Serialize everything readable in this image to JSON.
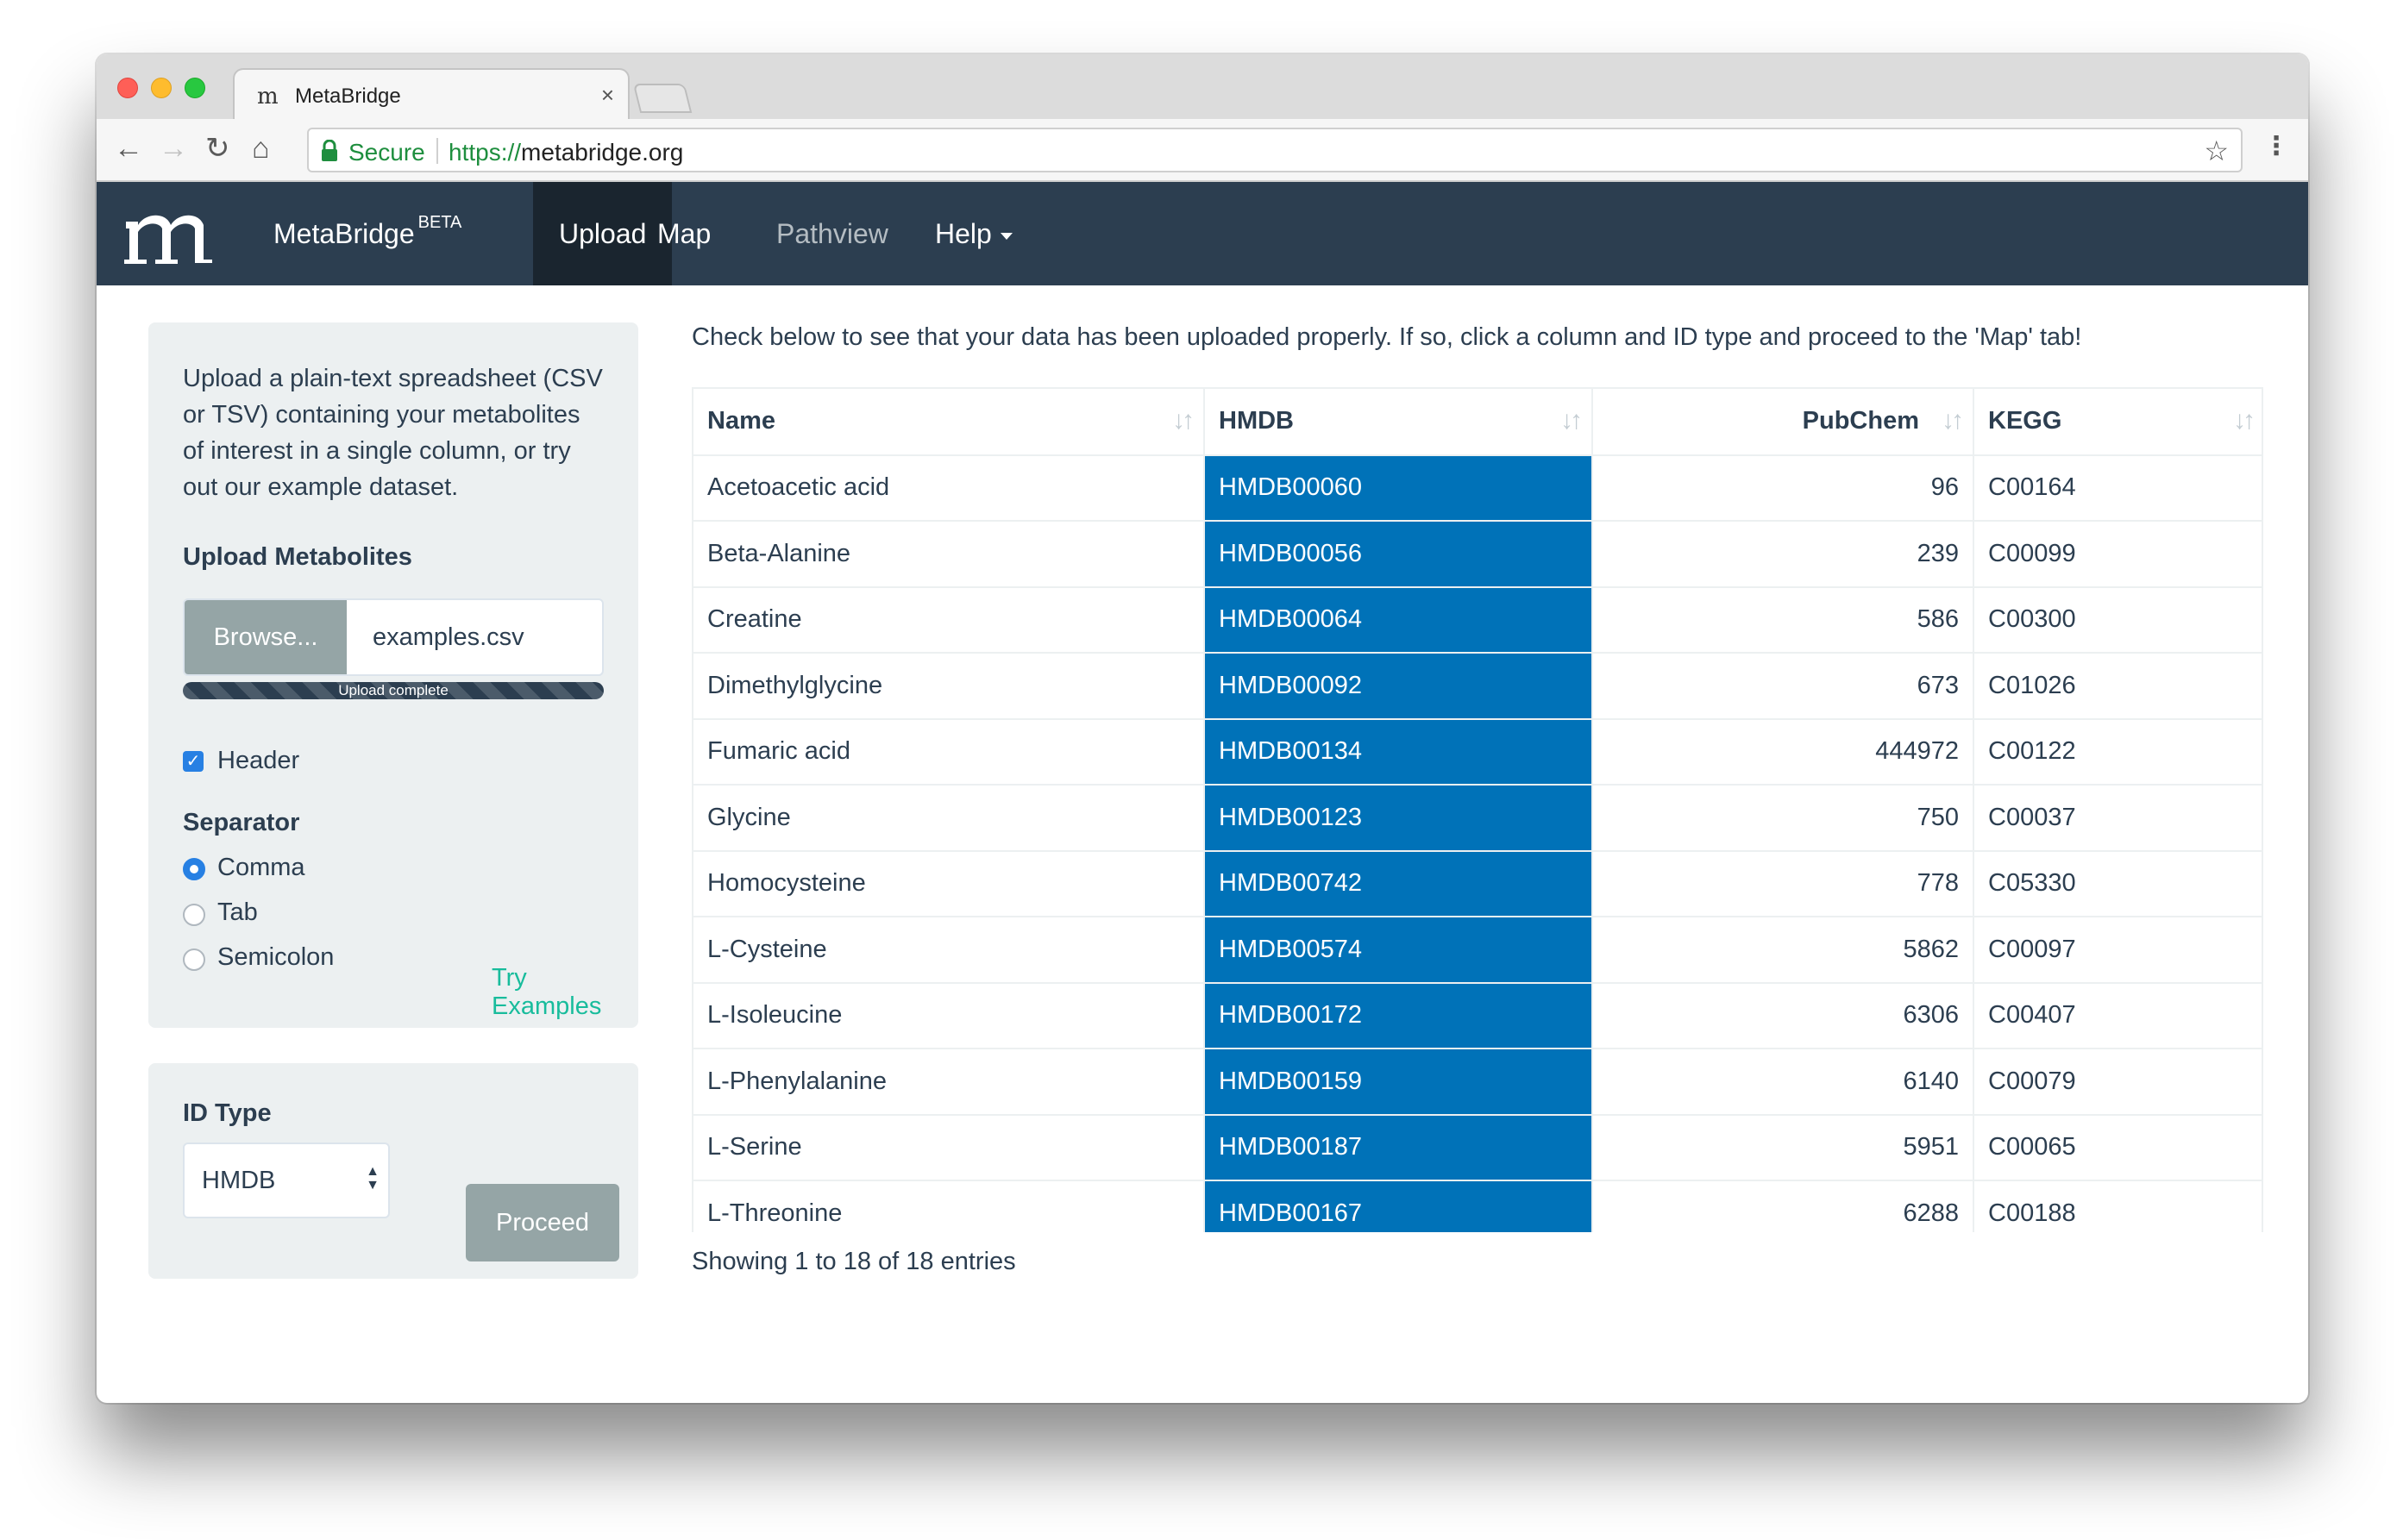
{
  "browser": {
    "tab_title": "MetaBridge",
    "tab_favicon": "m",
    "secure_label": "Secure",
    "url_scheme": "https://",
    "url_host": "metabridge.org"
  },
  "navbar": {
    "brand": "MetaBridge",
    "brand_badge": "BETA",
    "links": [
      "Upload",
      "Map",
      "Pathview",
      "Help"
    ],
    "active": "Upload"
  },
  "sidebar": {
    "help_text": "Upload a plain-text spreadsheet (CSV or TSV) containing your metabolites of interest in a single column, or try out our example dataset.",
    "upload_label": "Upload Metabolites",
    "browse_label": "Browse...",
    "file_name": "examples.csv",
    "progress_label": "Upload complete",
    "progress_value": 1.0,
    "header_label": "Header",
    "header_checked": true,
    "separator_label": "Separator",
    "separator_options": [
      "Comma",
      "Tab",
      "Semicolon"
    ],
    "separator_selected": "Comma",
    "try_examples": "Try Examples",
    "id_type_label": "ID Type",
    "id_type_value": "HMDB",
    "proceed_label": "Proceed"
  },
  "main": {
    "instruction": "Check below to see that your data has been uploaded properly. If so, click a column and ID type and proceed to the 'Map' tab!",
    "columns": [
      "Name",
      "HMDB",
      "PubChem",
      "KEGG"
    ],
    "selected_column": "HMDB",
    "selected_color": "#0072b8",
    "rows": [
      [
        "Acetoacetic acid",
        "HMDB00060",
        "96",
        "C00164"
      ],
      [
        "Beta-Alanine",
        "HMDB00056",
        "239",
        "C00099"
      ],
      [
        "Creatine",
        "HMDB00064",
        "586",
        "C00300"
      ],
      [
        "Dimethylglycine",
        "HMDB00092",
        "673",
        "C01026"
      ],
      [
        "Fumaric acid",
        "HMDB00134",
        "444972",
        "C00122"
      ],
      [
        "Glycine",
        "HMDB00123",
        "750",
        "C00037"
      ],
      [
        "Homocysteine",
        "HMDB00742",
        "778",
        "C05330"
      ],
      [
        "L-Cysteine",
        "HMDB00574",
        "5862",
        "C00097"
      ],
      [
        "L-Isoleucine",
        "HMDB00172",
        "6306",
        "C00407"
      ],
      [
        "L-Phenylalanine",
        "HMDB00159",
        "6140",
        "C00079"
      ],
      [
        "L-Serine",
        "HMDB00187",
        "5951",
        "C00065"
      ],
      [
        "L-Threonine",
        "HMDB00167",
        "6288",
        "C00188"
      ]
    ],
    "entries_info": "Showing 1 to 18 of 18 entries"
  },
  "colors": {
    "navbar": "#2c3e50",
    "navbar_active": "#1a252f",
    "panel": "#ecf0f1",
    "accent_link": "#18bc9c",
    "button_gray": "#95a5a6",
    "check_blue": "#2780e3"
  },
  "icons": [
    "back-arrow-icon",
    "forward-arrow-icon",
    "reload-icon",
    "home-icon",
    "lock-icon",
    "star-icon",
    "menu-dots-icon",
    "close-icon",
    "sort-icon",
    "caret-down-icon",
    "check-icon"
  ]
}
